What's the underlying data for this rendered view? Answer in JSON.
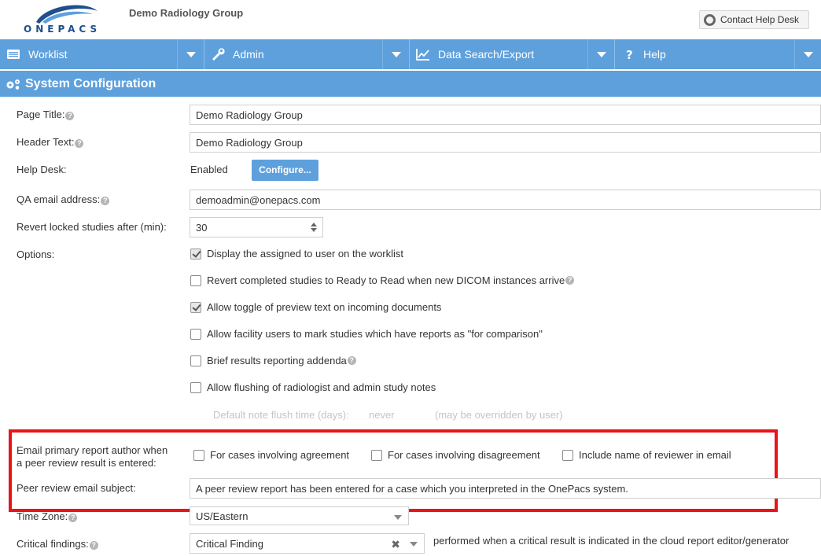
{
  "header": {
    "logo_text": "ONEPACS",
    "group_name": "Demo Radiology Group",
    "help_desk_label": "Contact Help Desk"
  },
  "nav": [
    {
      "label": "Worklist",
      "icon": "worklist-icon"
    },
    {
      "label": "Admin",
      "icon": "wrench-icon"
    },
    {
      "label": "Data Search/Export",
      "icon": "line-chart-icon"
    },
    {
      "label": "Help",
      "icon": "question-icon"
    }
  ],
  "section": {
    "title": "System Configuration",
    "icon": "gears-icon"
  },
  "form": {
    "page_title_label": "Page Title:",
    "page_title_value": "Demo Radiology Group",
    "header_text_label": "Header Text:",
    "header_text_value": "Demo Radiology Group",
    "help_desk_label": "Help Desk:",
    "help_desk_status": "Enabled",
    "configure_label": "Configure...",
    "qa_email_label": "QA email address:",
    "qa_email_value": "demoadmin@onepacs.com",
    "revert_label": "Revert locked studies after (min):",
    "revert_value": "30",
    "options_label": "Options:",
    "options": [
      {
        "label": "Display the assigned to user on the worklist",
        "checked": true,
        "help": false
      },
      {
        "label": "Revert completed studies to Ready to Read when new DICOM instances arrive",
        "checked": false,
        "help": true
      },
      {
        "label": "Allow toggle of preview text on incoming documents",
        "checked": true,
        "help": false
      },
      {
        "label": "Allow facility users to mark studies which have reports as \"for comparison\"",
        "checked": false,
        "help": false
      },
      {
        "label": "Brief results reporting addenda",
        "checked": false,
        "help": true
      },
      {
        "label": "Allow flushing of radiologist and admin study notes",
        "checked": false,
        "help": false
      }
    ],
    "flush_time_label": "Default note flush time (days):",
    "flush_time_value": "never",
    "flush_time_note": "(may be overridden by user)",
    "email_author_label_1": "Email primary report author when",
    "email_author_label_2": "a peer review result is entered:",
    "email_options": [
      {
        "label": "For cases involving agreement",
        "checked": false
      },
      {
        "label": "For cases involving disagreement",
        "checked": false
      },
      {
        "label": "Include name of reviewer in email",
        "checked": false
      }
    ],
    "peer_subject_label": "Peer review email subject:",
    "peer_subject_value": "A peer review report has been entered for a case which you interpreted in the OnePacs system.",
    "timezone_label": "Time Zone:",
    "timezone_value": "US/Eastern",
    "critical_label": "Critical findings:",
    "critical_value": "Critical Finding",
    "critical_note": "performed when a critical result is indicated in the cloud report editor/generator"
  },
  "colors": {
    "nav_blue": "#5ea0dc",
    "highlight_red": "#e8141a",
    "logo_blue": "#1f4f8c"
  }
}
